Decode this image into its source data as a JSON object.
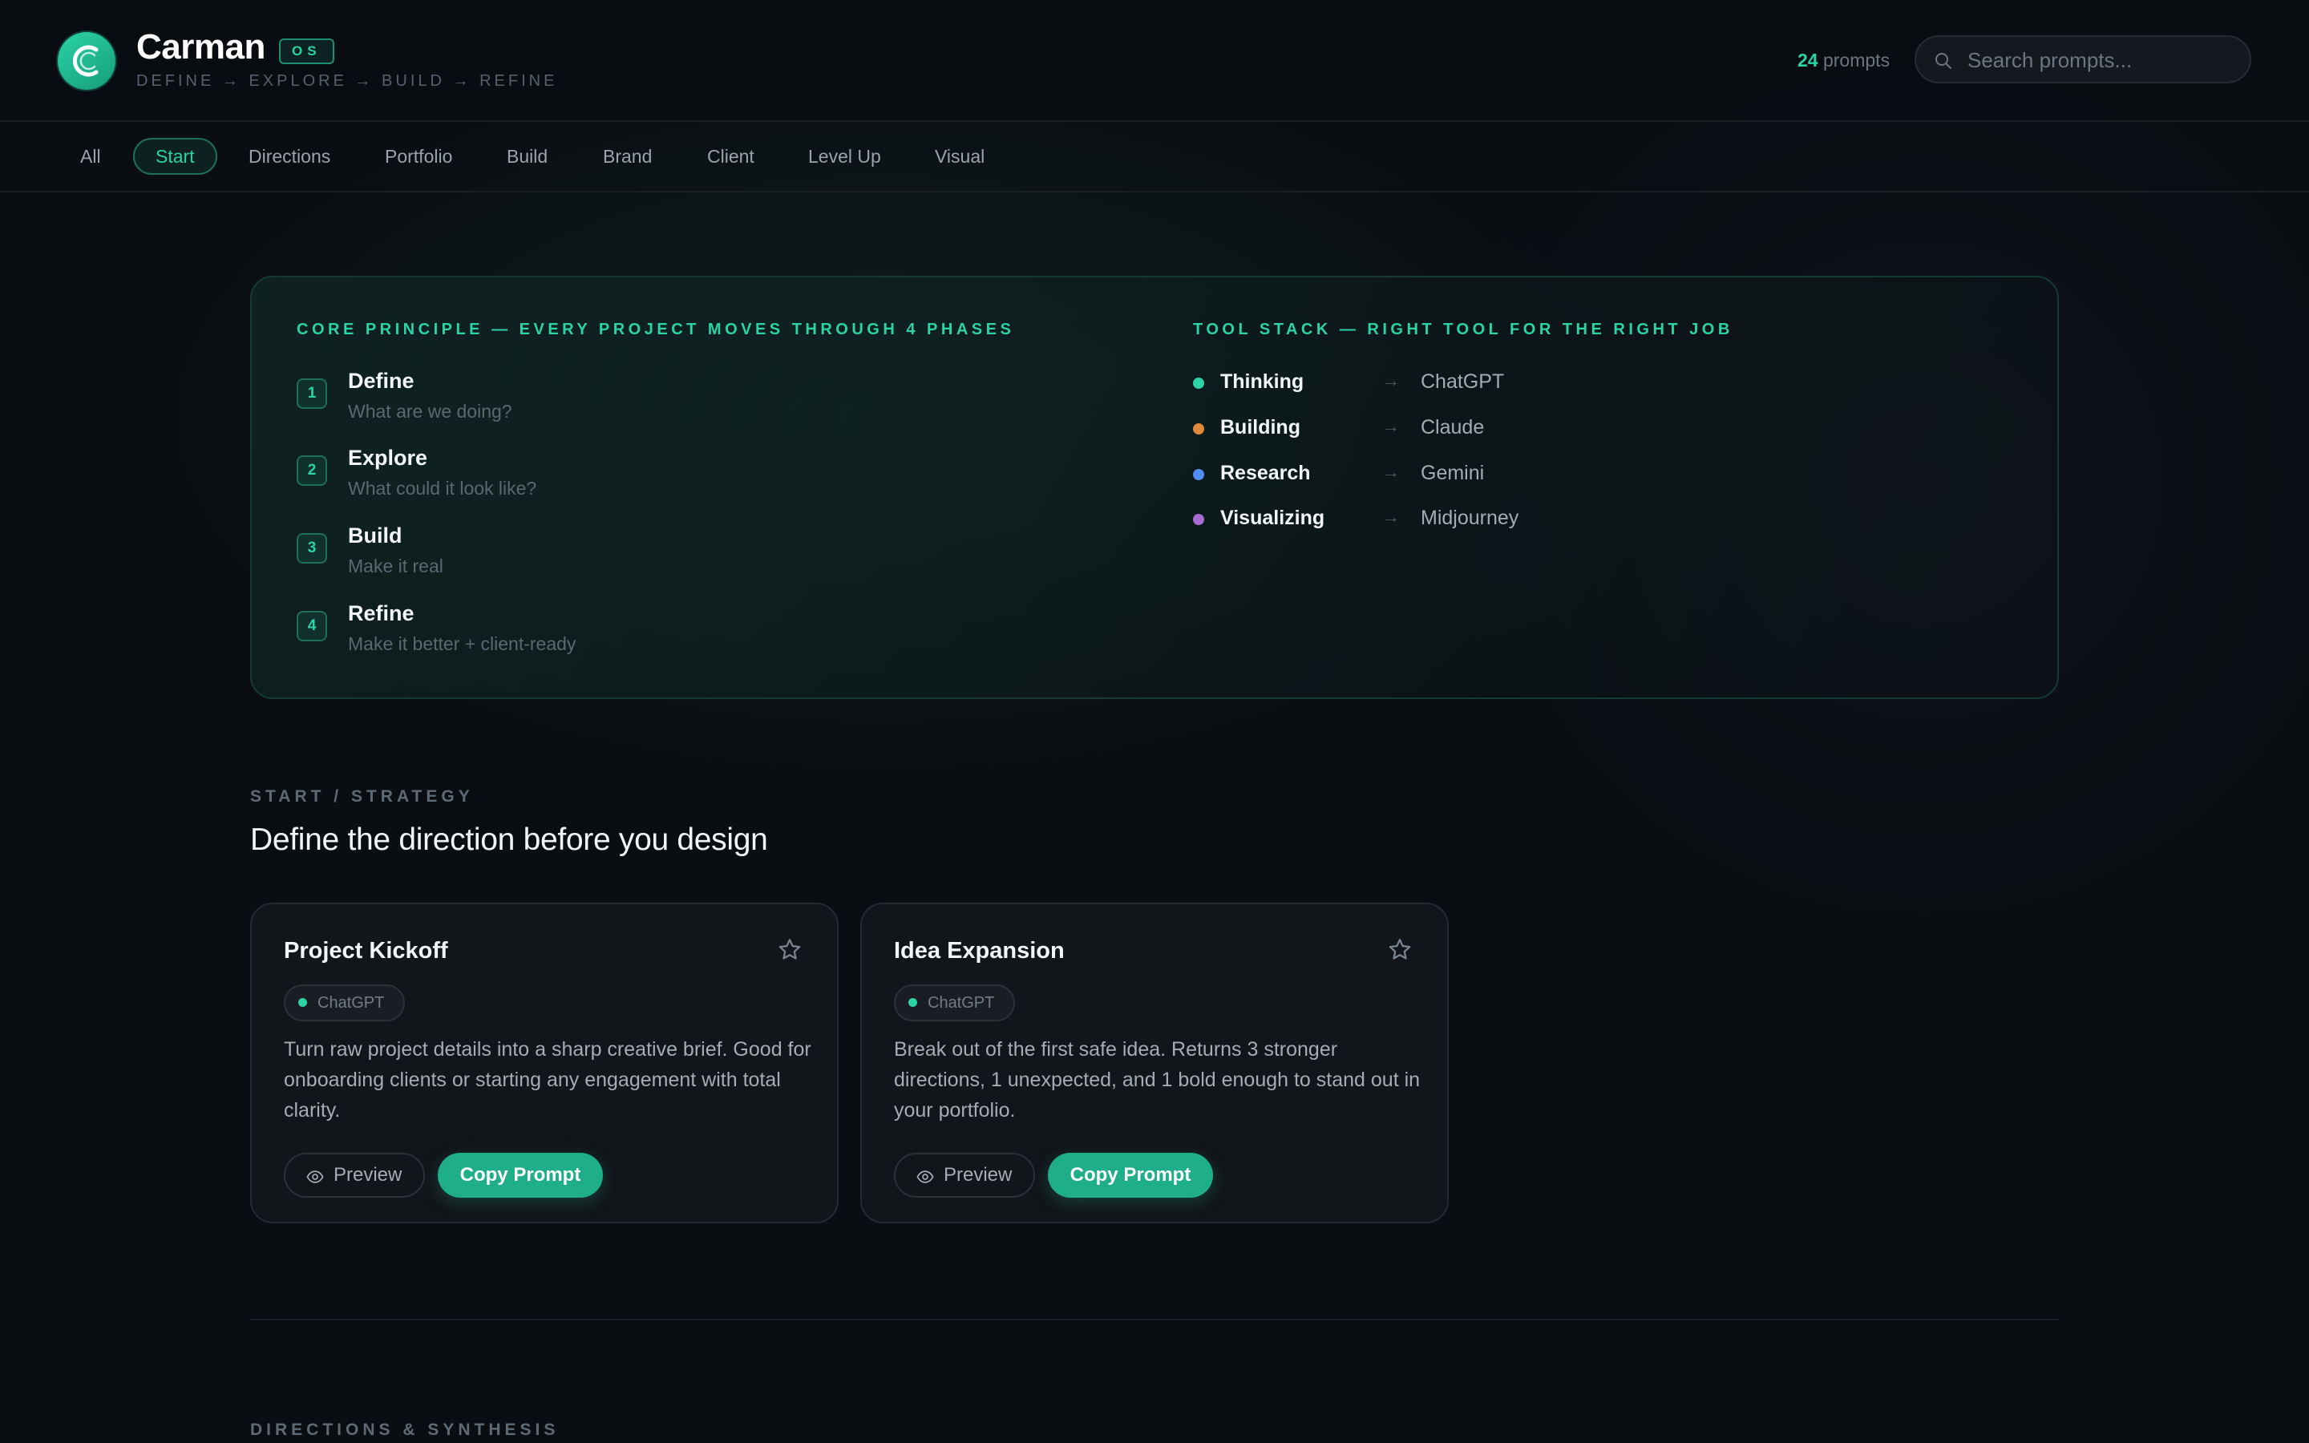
{
  "header": {
    "brand_name": "Carman",
    "brand_badge": "OS",
    "tagline": "DEFINE → EXPLORE → BUILD → REFINE",
    "prompt_count": "24",
    "prompt_count_label": "prompts",
    "search_placeholder": "Search prompts..."
  },
  "nav": {
    "items": [
      "All",
      "Start",
      "Directions",
      "Portfolio",
      "Build",
      "Brand",
      "Client",
      "Level Up",
      "Visual"
    ],
    "active": "Start"
  },
  "principle": {
    "heading": "CORE PRINCIPLE — EVERY PROJECT MOVES THROUGH 4 PHASES",
    "phases": [
      {
        "num": "1",
        "title": "Define",
        "subtitle": "What are we doing?"
      },
      {
        "num": "2",
        "title": "Explore",
        "subtitle": "What could it look like?"
      },
      {
        "num": "3",
        "title": "Build",
        "subtitle": "Make it real"
      },
      {
        "num": "4",
        "title": "Refine",
        "subtitle": "Make it better + client-ready"
      }
    ]
  },
  "tool_stack": {
    "heading": "TOOL STACK — RIGHT TOOL FOR THE RIGHT JOB",
    "tools": [
      {
        "task": "Thinking",
        "arrow": "→",
        "app": "ChatGPT",
        "color": "#2bd3a6"
      },
      {
        "task": "Building",
        "arrow": "→",
        "app": "Claude",
        "color": "#e08a3c"
      },
      {
        "task": "Research",
        "arrow": "→",
        "app": "Gemini",
        "color": "#4f8ef7"
      },
      {
        "task": "Visualizing",
        "arrow": "→",
        "app": "Midjourney",
        "color": "#a86bd6"
      }
    ]
  },
  "section": {
    "eyebrow": "START / STRATEGY",
    "title": "Define the direction before you design"
  },
  "cards": [
    {
      "title": "Project Kickoff",
      "tag": "ChatGPT",
      "description": "Turn raw project details into a sharp creative brief. Good for onboarding clients or starting any engagement with total clarity.",
      "preview_label": "Preview",
      "copy_label": "Copy Prompt"
    },
    {
      "title": "Idea Expansion",
      "tag": "ChatGPT",
      "description": "Break out of the first safe idea. Returns 3 stronger directions, 1 unexpected, and 1 bold enough to stand out in your portfolio.",
      "preview_label": "Preview",
      "copy_label": "Copy Prompt"
    }
  ],
  "section2": {
    "eyebrow": "DIRECTIONS & SYNTHESIS"
  },
  "colors": {
    "accent": "#2bd3a6",
    "button": "#1fae8a",
    "background": "#0a0d12"
  }
}
